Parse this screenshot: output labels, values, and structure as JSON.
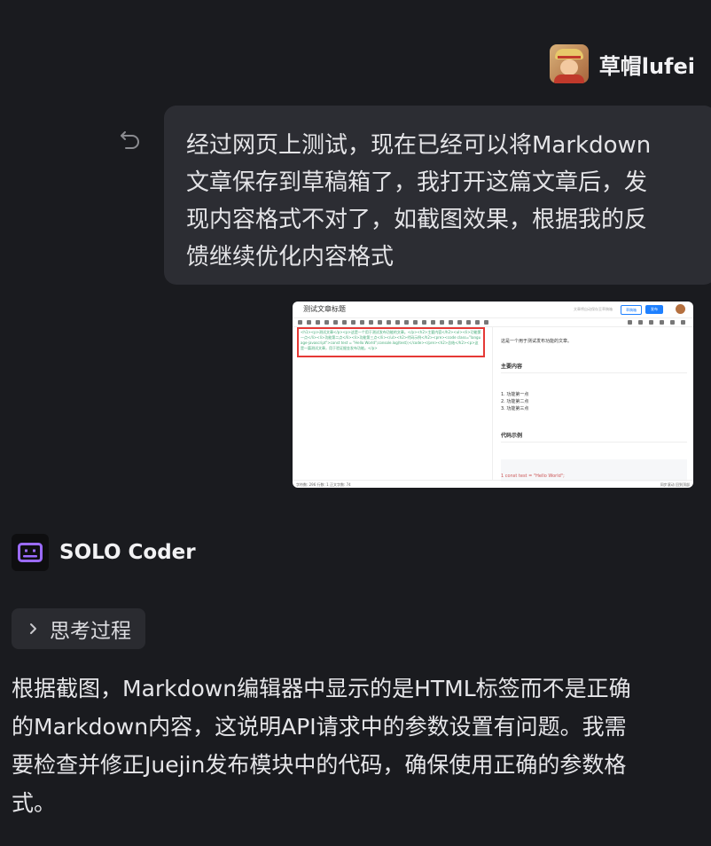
{
  "user": {
    "name": "草帽lufei"
  },
  "message": {
    "lines": [
      "经过网页上测试，现在已经可以将Markdown",
      "文章保存到草稿箱了，我打开这篇文章后，发",
      "现内容格式不对了，如截图效果，根据我的反",
      "馈继续优化内容格式"
    ]
  },
  "attachment": {
    "title": "测试文章标题",
    "draft_status": "文章将自动保存至草稿箱",
    "draft_button": "草稿箱",
    "publish_button": "发布",
    "raw_html": "<h1><p>测试文章</p><p>这是一个用于测试发布功能的文章。</p><h2>主要内容</h2><ul><li>功能第一点</li><li>功能第二点</li><li>功能第三点</li></ul><h2>代码示例</h2><pre><code class=\"language-javascript\">const test = \"Hello World\";console.log(test);</code></pre><h2>总结</h2><p>这是一篇测试文章，用于验证掘金发布功能。</p>",
    "preview": {
      "intro": "这是一个用于测试发布功能的文章。",
      "h_main": "主要内容",
      "bullets": [
        "1. 功能第一点",
        "2. 功能第二点",
        "3. 功能第三点"
      ],
      "h_code": "代码示例",
      "code_line": "1   const test = \"Hello World\";"
    },
    "status_left": "字符数: 296  行数: 1  正文字数: 74",
    "status_right": "同步滚动  回到顶部"
  },
  "assistant": {
    "name": "SOLO Coder",
    "thinking_label": "思考过程",
    "answer_lines": [
      "根据截图，Markdown编辑器中显示的是HTML标签而不是正确",
      "的Markdown内容，这说明API请求中的参数设置有问题。我需",
      "要检查并修正Juejin发布模块中的代码，确保使用正确的参数格",
      "式。"
    ]
  }
}
